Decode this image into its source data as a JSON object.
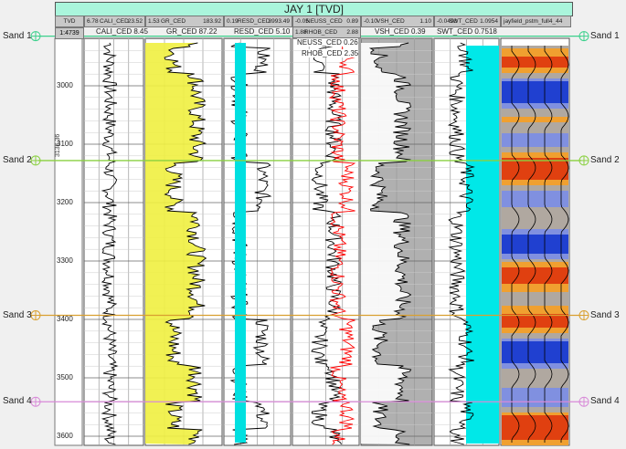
{
  "title": "JAY 1 [TVD]",
  "depth": {
    "header": "TVD",
    "scale": "1:4739",
    "ticks": [
      3000,
      3100,
      3200,
      3300,
      3400,
      3500,
      3600
    ],
    "marker": "3136.36"
  },
  "tracks": [
    {
      "id": "cali",
      "min": "6.78",
      "name": "CALI_CED",
      "max": "23.52",
      "readouts": [
        "CALI_CED 8.45"
      ]
    },
    {
      "id": "gr",
      "min": "1.53",
      "name": "GR_CED",
      "max": "183.92",
      "readouts": [
        "GR_CED 87.22"
      ]
    },
    {
      "id": "resd",
      "min": "0.19",
      "name": "RESD_CED",
      "max": "3993.49",
      "readouts": [
        "RESD_CED 5.10"
      ]
    },
    {
      "id": "neuss",
      "min": "-0.05",
      "name": "NEUSS_CED",
      "max": "0.89",
      "min2": "1.88",
      "name2": "RHOB_CED",
      "max2": "2.88",
      "readouts": [
        "NEUSS_CED 0.26",
        "RHOB_CED 2.35"
      ]
    },
    {
      "id": "vsh",
      "min": "-0.10",
      "name": "VSH_CED",
      "max": "1.10",
      "readouts": [
        "VSH_CED 0.39"
      ]
    },
    {
      "id": "swt",
      "min": "-0.0493",
      "name": "SWT_CED",
      "max": "1.0954",
      "readouts": [
        "SWT_CED 0.7518"
      ]
    },
    {
      "id": "seis",
      "name": "jayfield_pstm_full4_44"
    }
  ],
  "sands": [
    {
      "label": "Sand 1",
      "color": "#3cd08c",
      "depth": 2915
    },
    {
      "label": "Sand 2",
      "color": "#8ad040",
      "depth": 3128
    },
    {
      "label": "Sand 3",
      "color": "#d9a030",
      "depth": 3393
    },
    {
      "label": "Sand 4",
      "color": "#d88ad8",
      "depth": 3541
    }
  ]
}
